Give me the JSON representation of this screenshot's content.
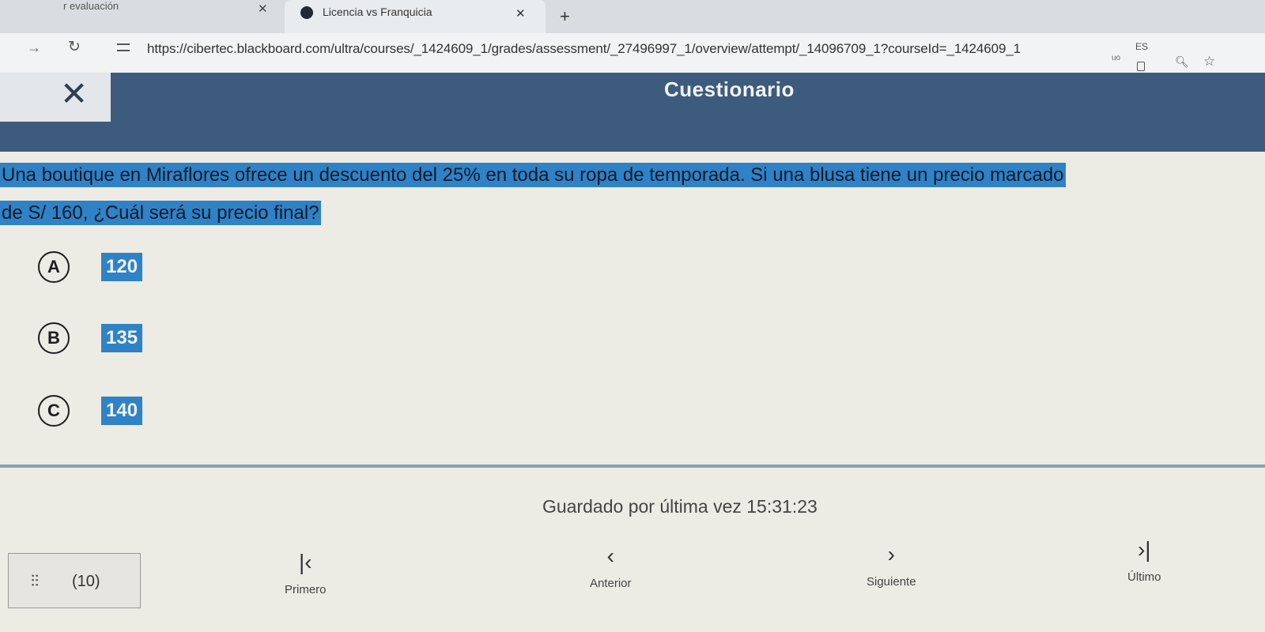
{
  "browser": {
    "prev_tab_label": "r evaluación",
    "active_tab_title": "Licencia vs Franquicia",
    "new_tab_glyph": "+",
    "url": "https://cibertec.blackboard.com/ultra/courses/_1424609_1/grades/assessment/_27496997_1/overview/attempt/_14096709_1?courseId=_1424609_1",
    "lang_badge": "ES",
    "ext_text": "uo"
  },
  "header": {
    "title": "Cuestionario"
  },
  "question": {
    "line1": "Una boutique en Miraflores ofrece un descuento del 25% en toda su ropa de temporada. Si una blusa tiene un precio marcado",
    "line2": "de S/ 160, ¿Cuál será su precio final?"
  },
  "options": [
    {
      "letter": "A",
      "value": "120"
    },
    {
      "letter": "B",
      "value": "135"
    },
    {
      "letter": "C",
      "value": "140"
    }
  ],
  "status": {
    "saved_text": "Guardado por última vez 15:31:23"
  },
  "footer": {
    "question_count": "(10)",
    "first_label": "Primero",
    "previous_label": "Anterior",
    "next_label": "Siguiente",
    "last_label": "Último"
  },
  "icons": {
    "close": "close-icon",
    "reload": "reload-icon",
    "forward": "arrow-right-icon",
    "site_info": "tune-icon",
    "zoom": "zoom-icon",
    "star": "star-icon",
    "questions": "question-list-icon",
    "first": "skip-first-icon",
    "previous": "chevron-left-icon",
    "next": "chevron-right-icon",
    "last": "skip-last-icon"
  },
  "colors": {
    "header_bg": "#3c5b7d",
    "highlight": "#2f82c6",
    "page_bg": "#ecebe4"
  }
}
